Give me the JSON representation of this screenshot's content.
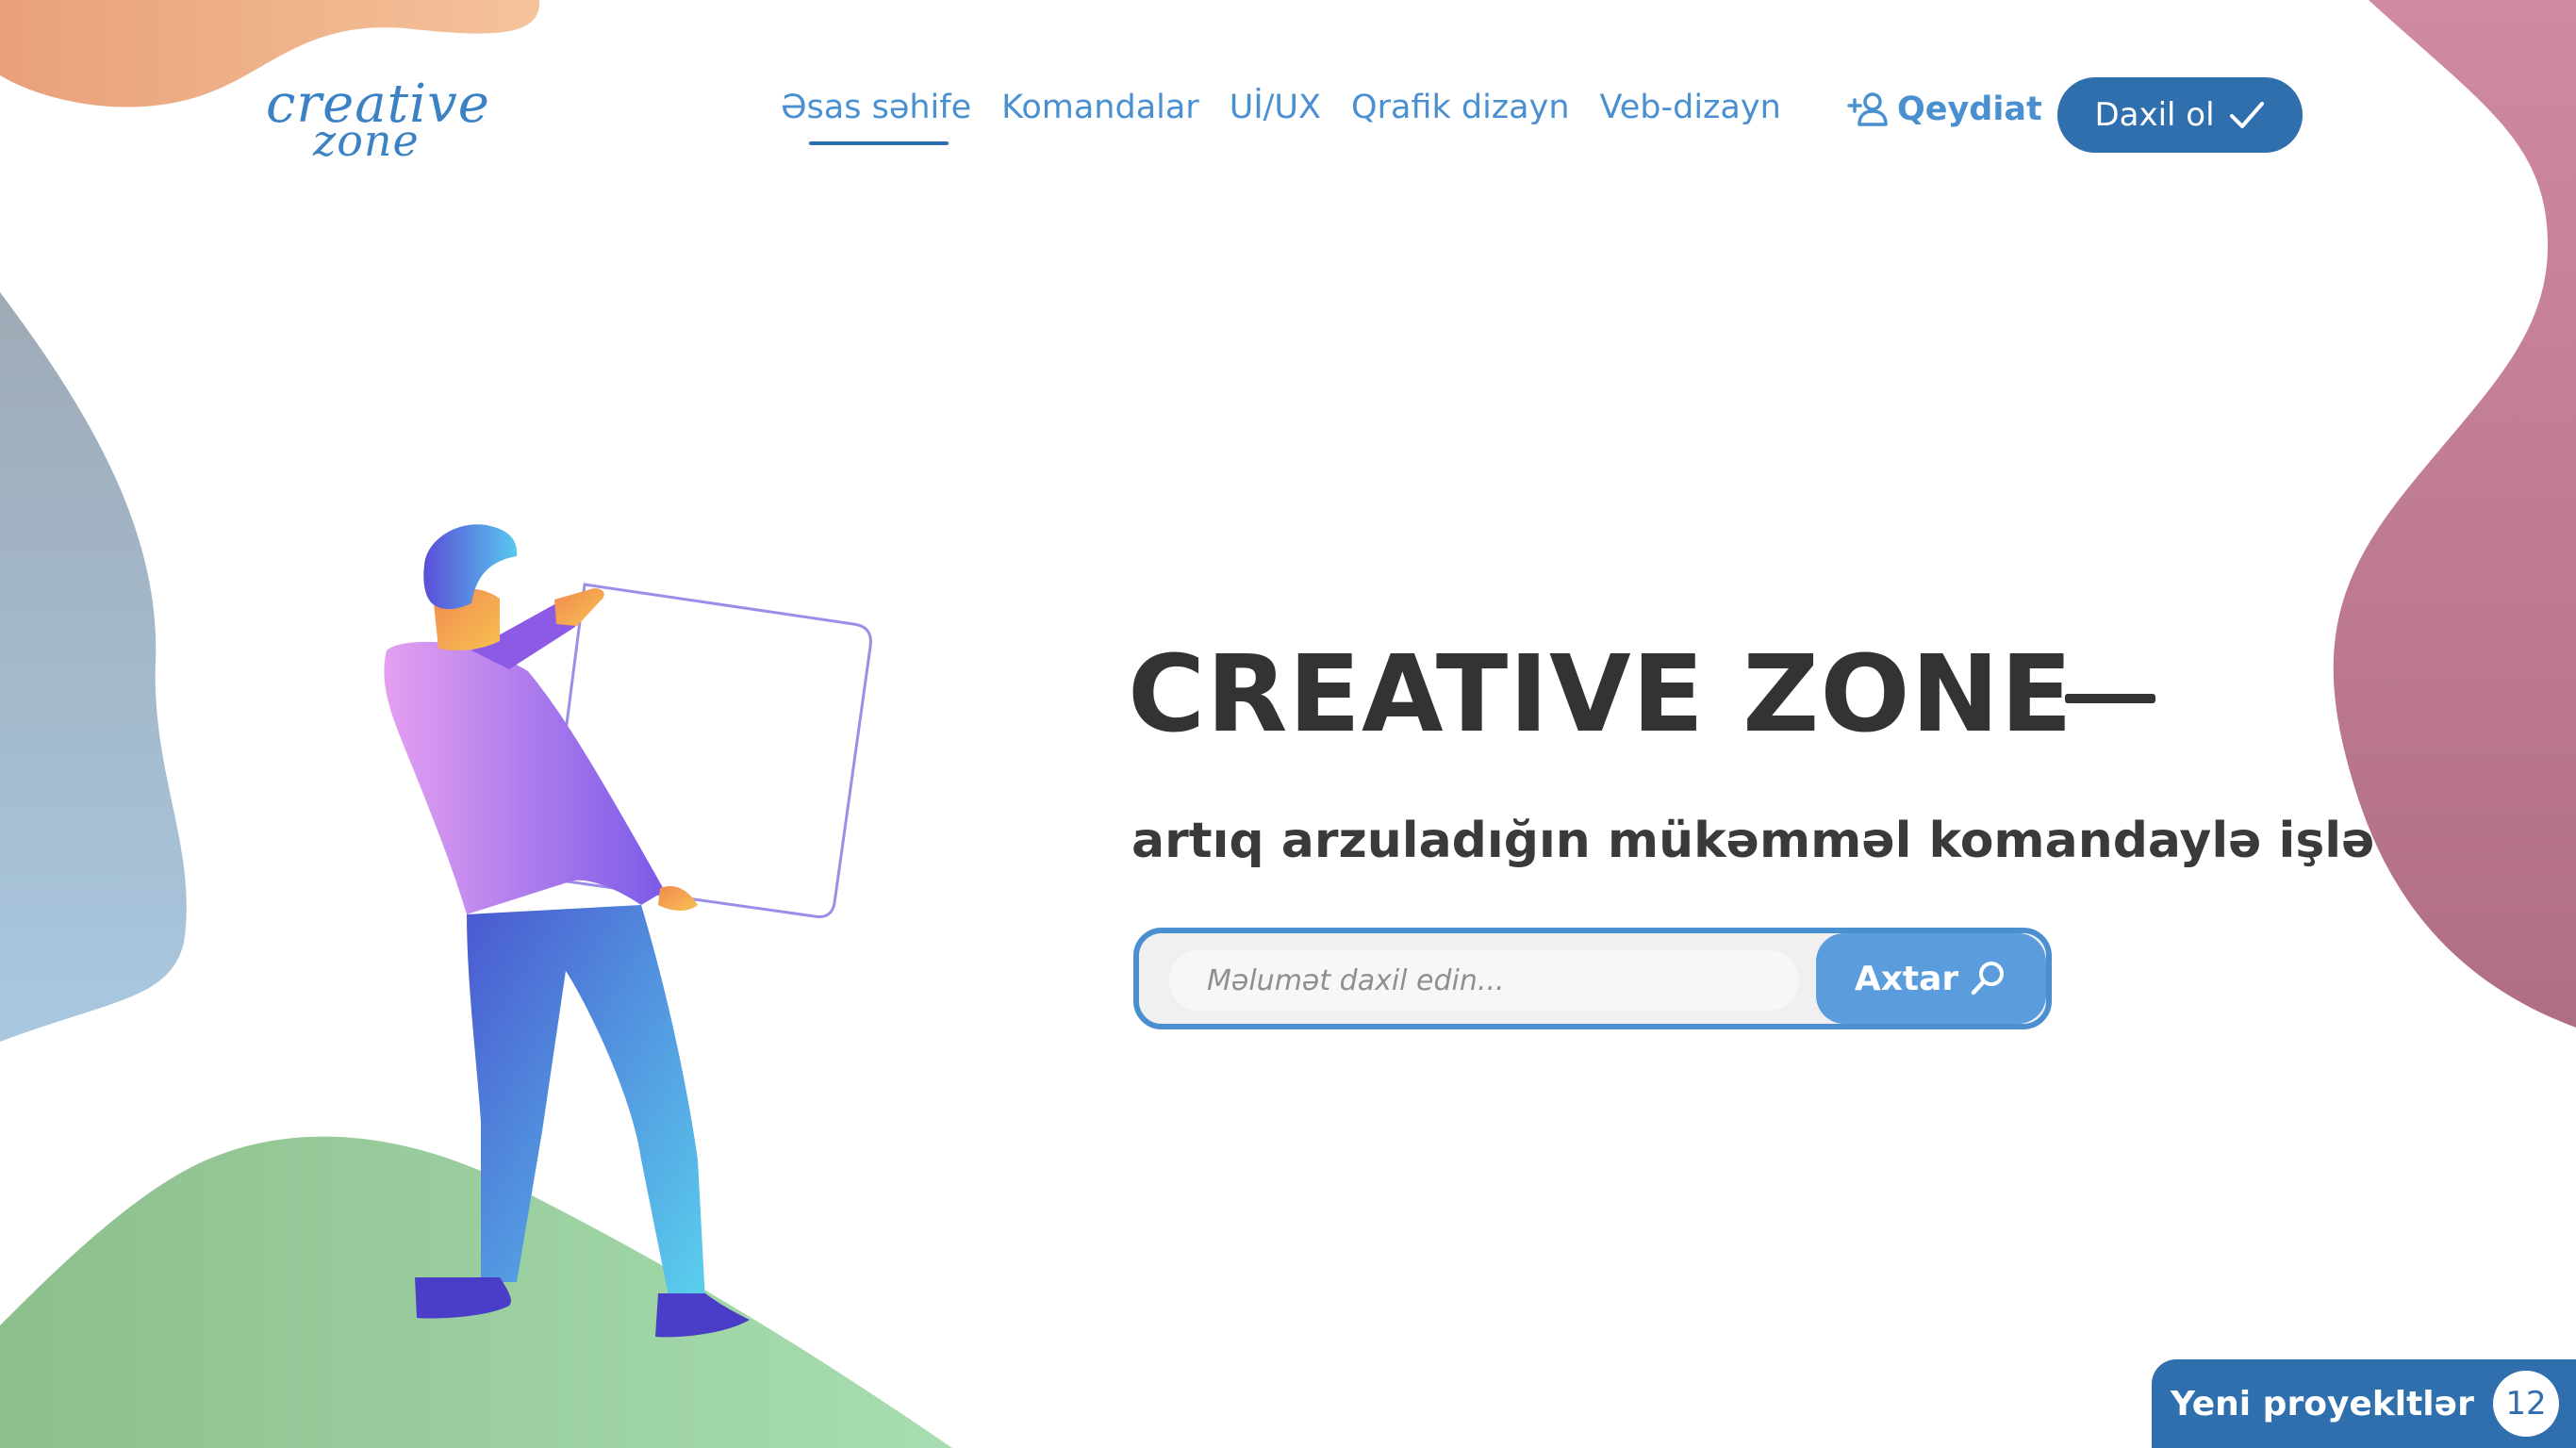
{
  "logo": {
    "line1": "creative",
    "line2": "zone"
  },
  "nav": {
    "items": [
      {
        "label": "Əsas səhife",
        "active": true
      },
      {
        "label": "Komandalar",
        "active": false
      },
      {
        "label": "Uİ/UX",
        "active": false
      },
      {
        "label": "Qrafik dizayn",
        "active": false
      },
      {
        "label": "Veb-dizayn",
        "active": false
      }
    ],
    "register_label": "Qeydiat",
    "register_icon": "add-user-icon",
    "login_label": "Daxil ol",
    "login_icon": "checkmark-icon"
  },
  "hero": {
    "title": "CREATIVE ZONE",
    "subtitle": "artıq arzuladığın mükəmməl komandaylə işlə"
  },
  "search": {
    "placeholder": "Məlumət daxil edin...",
    "button_label": "Axtar",
    "button_icon": "search-icon"
  },
  "projects": {
    "label": "Yeni proyekltlər",
    "count": "12"
  },
  "colors": {
    "primary": "#2f6fad",
    "link": "#4a90d0",
    "search_button": "#5b9cdc",
    "title": "#333333"
  }
}
